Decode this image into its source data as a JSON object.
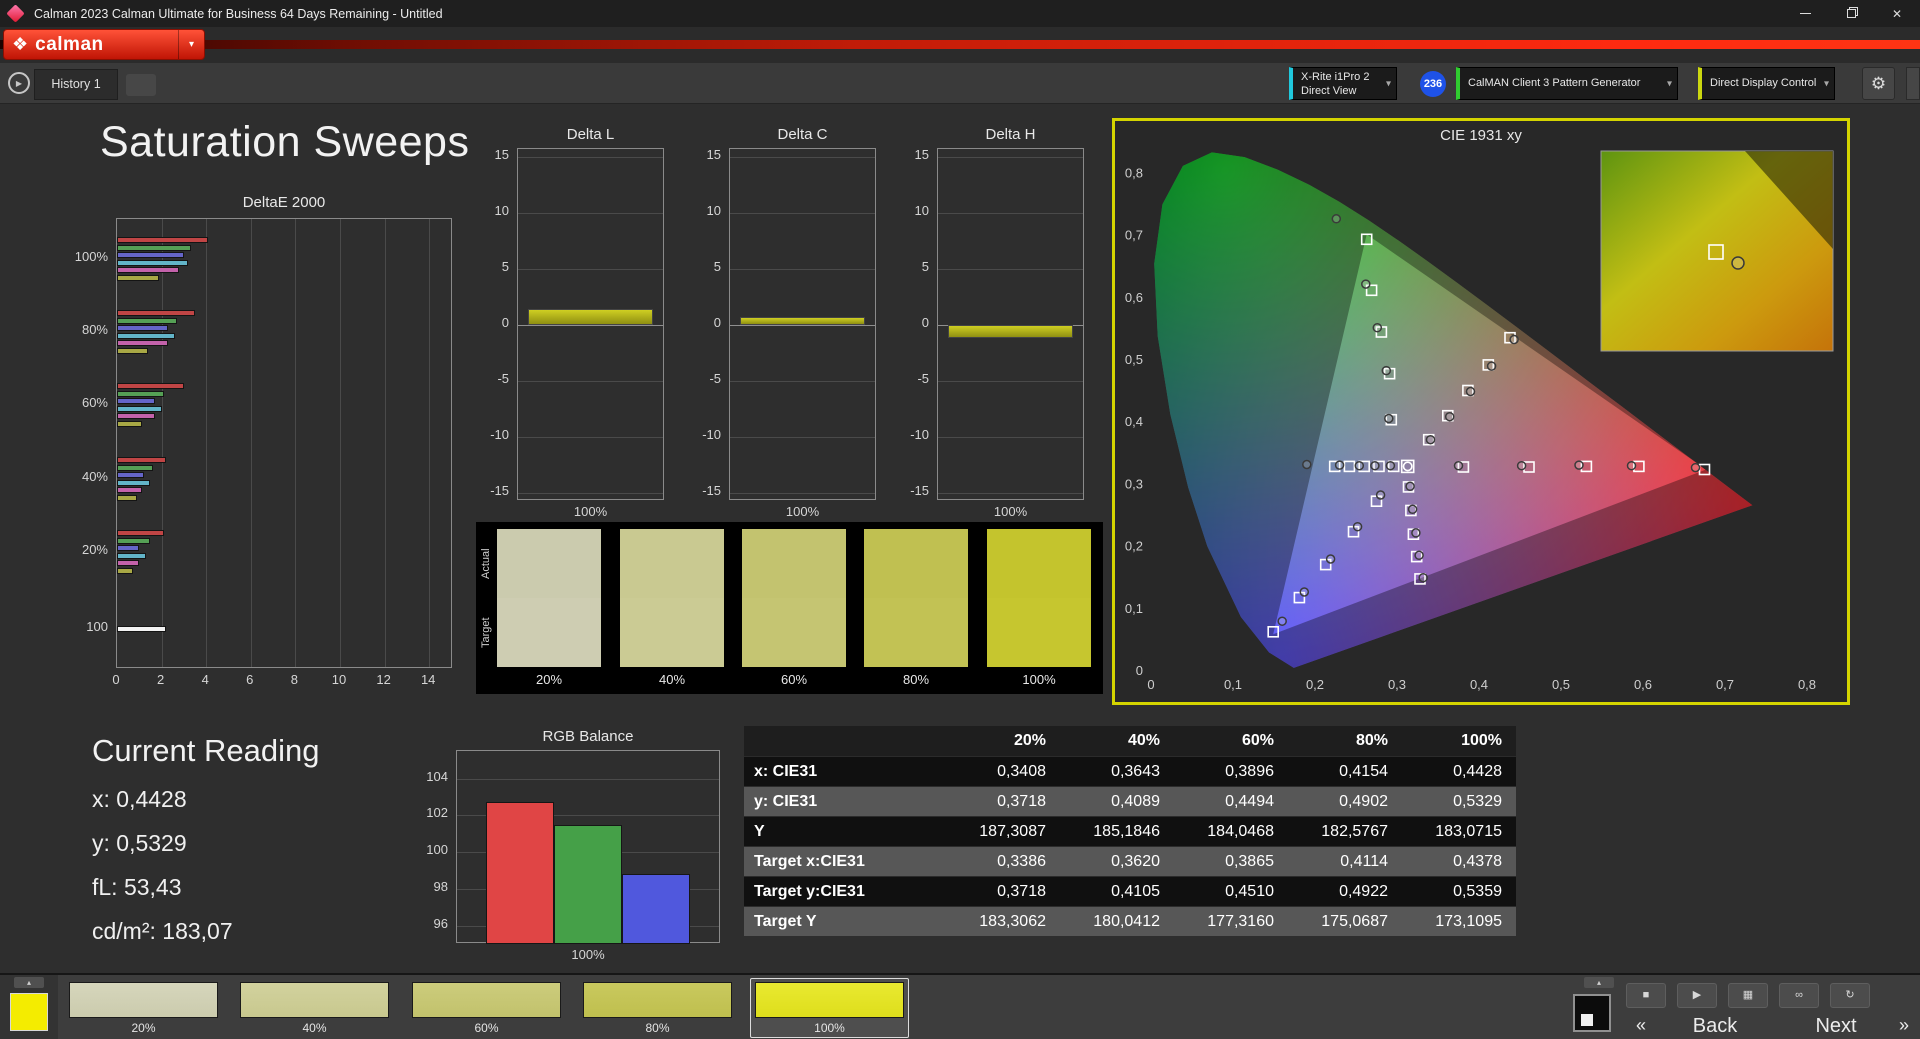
{
  "window": {
    "title": "Calman 2023 Calman Ultimate for Business 64 Days Remaining  - Untitled"
  },
  "brand": {
    "logo_text": "calman"
  },
  "icons": {
    "logo_diamond": "❖",
    "dropdown_caret": "▾",
    "history_arrow": "▶",
    "gear": "⚙",
    "close": "✕",
    "chevron_up": "▴",
    "stop": "■",
    "play": "▶",
    "save": "▦",
    "link": "∞",
    "refresh": "↻",
    "back_arrow": "«",
    "next_arrow": "»"
  },
  "toolbar": {
    "history_tab": "History 1",
    "meter_line1": "X-Rite i1Pro 2",
    "meter_line2": "Direct View",
    "meter_badge": "236",
    "source": "CalMAN Client 3 Pattern Generator",
    "display_control": "Direct Display Control"
  },
  "page_title": "Saturation Sweeps",
  "current_reading": {
    "title": "Current Reading",
    "lines": [
      "x: 0,4428",
      "y: 0,5329",
      "fL: 53,43",
      "cd/m²: 183,07"
    ]
  },
  "bottom_bar": {
    "back_label": "Back",
    "next_label": "Next",
    "pattern_color": "#f4ec00",
    "swatches": [
      {
        "label": "20%",
        "color": "#cbcbad",
        "color_top": "#d6d6bc",
        "selected": false
      },
      {
        "label": "40%",
        "color": "#c8c88e",
        "color_top": "#d2d29e",
        "selected": false
      },
      {
        "label": "60%",
        "color": "#c2c26c",
        "color_top": "#cccc7c",
        "selected": false
      },
      {
        "label": "80%",
        "color": "#bfbf4e",
        "color_top": "#c9c95e",
        "selected": false
      },
      {
        "label": "100%",
        "color": "#dede1c",
        "color_top": "#e9e930",
        "selected": true
      }
    ]
  },
  "chart_data": {
    "deltae": {
      "type": "bar",
      "orientation": "horizontal",
      "title": "DeltaE 2000",
      "xlim": [
        0,
        14
      ],
      "x_ticks": [
        0,
        2,
        4,
        6,
        8,
        10,
        12,
        14
      ],
      "series_colors": {
        "red": "#c04545",
        "green": "#55a055",
        "blue": "#6565c8",
        "cyan": "#62b4c8",
        "magenta": "#c362aa",
        "yellow": "#a8a845",
        "white": "#f2f2f2"
      },
      "groups": [
        {
          "label": "100%",
          "bars": [
            [
              "red",
              4.1
            ],
            [
              "green",
              3.3
            ],
            [
              "blue",
              3.0
            ],
            [
              "cyan",
              3.2
            ],
            [
              "magenta",
              2.8
            ],
            [
              "yellow",
              1.9
            ]
          ]
        },
        {
          "label": "80%",
          "bars": [
            [
              "red",
              3.5
            ],
            [
              "green",
              2.7
            ],
            [
              "blue",
              2.3
            ],
            [
              "cyan",
              2.6
            ],
            [
              "magenta",
              2.3
            ],
            [
              "yellow",
              1.4
            ]
          ]
        },
        {
          "label": "60%",
          "bars": [
            [
              "red",
              3.0
            ],
            [
              "green",
              2.1
            ],
            [
              "blue",
              1.7
            ],
            [
              "cyan",
              2.0
            ],
            [
              "magenta",
              1.7
            ],
            [
              "yellow",
              1.1
            ]
          ]
        },
        {
          "label": "40%",
          "bars": [
            [
              "red",
              2.2
            ],
            [
              "green",
              1.6
            ],
            [
              "blue",
              1.2
            ],
            [
              "cyan",
              1.5
            ],
            [
              "magenta",
              1.1
            ],
            [
              "yellow",
              0.9
            ]
          ]
        },
        {
          "label": "20%",
          "bars": [
            [
              "red",
              2.1
            ],
            [
              "green",
              1.5
            ],
            [
              "blue",
              1.0
            ],
            [
              "cyan",
              1.3
            ],
            [
              "magenta",
              1.0
            ],
            [
              "yellow",
              0.7
            ]
          ]
        },
        {
          "label": "100",
          "bars": [
            [
              "white",
              2.2
            ]
          ]
        }
      ]
    },
    "delta_l": {
      "type": "bar",
      "title": "Delta L",
      "categories": [
        "100%"
      ],
      "values": [
        1.4
      ],
      "ylim": [
        -15,
        15
      ],
      "y_ticks": [
        15,
        10,
        5,
        0,
        -5,
        -10,
        -15
      ],
      "bar_color": "#b5b521"
    },
    "delta_c": {
      "type": "bar",
      "title": "Delta C",
      "categories": [
        "100%"
      ],
      "values": [
        0.7
      ],
      "ylim": [
        -15,
        15
      ],
      "y_ticks": [
        15,
        10,
        5,
        0,
        -5,
        -10,
        -15
      ],
      "bar_color": "#b5b521"
    },
    "delta_h": {
      "type": "bar",
      "title": "Delta H",
      "categories": [
        "100%"
      ],
      "values": [
        -1.2
      ],
      "ylim": [
        -15,
        15
      ],
      "y_ticks": [
        15,
        10,
        5,
        0,
        -5,
        -10,
        -15
      ],
      "bar_color": "#b5b521"
    },
    "cie": {
      "type": "scatter",
      "title": "CIE 1931 xy",
      "xlim": [
        0,
        0.8
      ],
      "ylim": [
        0,
        0.8
      ],
      "x_ticks": [
        "0",
        "0,1",
        "0,2",
        "0,3",
        "0,4",
        "0,5",
        "0,6",
        "0,7",
        "0,8"
      ],
      "y_ticks": [
        "0",
        "0,1",
        "0,2",
        "0,3",
        "0,4",
        "0,5",
        "0,6",
        "0,7",
        "0,8"
      ],
      "white_point": [
        0.313,
        0.329
      ],
      "gamut_triangle": [
        [
          0.677,
          0.324
        ],
        [
          0.263,
          0.702
        ],
        [
          0.149,
          0.059
        ]
      ],
      "sweeps": [
        {
          "name": "red",
          "targets": [
            [
              0.381,
              0.328
            ],
            [
              0.461,
              0.328
            ],
            [
              0.531,
              0.329
            ],
            [
              0.595,
              0.329
            ],
            [
              0.675,
              0.324
            ]
          ],
          "measured": [
            [
              0.375,
              0.33
            ],
            [
              0.452,
              0.33
            ],
            [
              0.522,
              0.331
            ],
            [
              0.586,
              0.33
            ],
            [
              0.664,
              0.327
            ]
          ]
        },
        {
          "name": "green",
          "targets": [
            [
              0.293,
              0.404
            ],
            [
              0.291,
              0.478
            ],
            [
              0.281,
              0.545
            ],
            [
              0.269,
              0.612
            ],
            [
              0.263,
              0.694
            ]
          ],
          "measured": [
            [
              0.29,
              0.406
            ],
            [
              0.287,
              0.483
            ],
            [
              0.276,
              0.552
            ],
            [
              0.262,
              0.622
            ],
            [
              0.226,
              0.727
            ]
          ]
        },
        {
          "name": "blue",
          "targets": [
            [
              0.275,
              0.273
            ],
            [
              0.247,
              0.224
            ],
            [
              0.213,
              0.171
            ],
            [
              0.181,
              0.118
            ],
            [
              0.149,
              0.063
            ]
          ],
          "measured": [
            [
              0.28,
              0.283
            ],
            [
              0.252,
              0.232
            ],
            [
              0.219,
              0.18
            ],
            [
              0.187,
              0.127
            ],
            [
              0.16,
              0.08
            ]
          ]
        },
        {
          "name": "cyan",
          "targets": [
            [
              0.296,
              0.329
            ],
            [
              0.278,
              0.329
            ],
            [
              0.26,
              0.329
            ],
            [
              0.242,
              0.329
            ],
            [
              0.224,
              0.329
            ]
          ],
          "measured": [
            [
              0.292,
              0.33
            ],
            [
              0.273,
              0.33
            ],
            [
              0.254,
              0.33
            ],
            [
              0.23,
              0.331
            ],
            [
              0.19,
              0.332
            ]
          ]
        },
        {
          "name": "magenta",
          "targets": [
            [
              0.314,
              0.296
            ],
            [
              0.317,
              0.258
            ],
            [
              0.32,
              0.22
            ],
            [
              0.324,
              0.184
            ],
            [
              0.328,
              0.148
            ]
          ],
          "measured": [
            [
              0.316,
              0.297
            ],
            [
              0.319,
              0.26
            ],
            [
              0.323,
              0.222
            ],
            [
              0.327,
              0.186
            ],
            [
              0.332,
              0.15
            ]
          ]
        },
        {
          "name": "yellow",
          "targets": [
            [
              0.3386,
              0.3718
            ],
            [
              0.362,
              0.4105
            ],
            [
              0.3865,
              0.451
            ],
            [
              0.4114,
              0.4922
            ],
            [
              0.4378,
              0.5359
            ]
          ],
          "measured": [
            [
              0.3408,
              0.3718
            ],
            [
              0.3643,
              0.4089
            ],
            [
              0.3896,
              0.4494
            ],
            [
              0.4154,
              0.4902
            ],
            [
              0.4428,
              0.5329
            ]
          ]
        }
      ]
    },
    "saturation_swatches": {
      "type": "swatches",
      "row_labels": [
        "Actual",
        "Target"
      ],
      "columns": [
        "20%",
        "40%",
        "60%",
        "80%",
        "100%"
      ],
      "actual_colors": [
        "#cbcbae",
        "#c9c991",
        "#c3c36f",
        "#c0c051",
        "#c4c42d"
      ],
      "target_colors": [
        "#cecdb2",
        "#cbcb94",
        "#c5c572",
        "#c2c254",
        "#c6c62f"
      ]
    },
    "rgb_balance": {
      "type": "bar",
      "title": "RGB Balance",
      "categories": [
        "Red",
        "Green",
        "Blue"
      ],
      "values": [
        102.7,
        101.5,
        98.8
      ],
      "colors": [
        "#e04545",
        "#45a048",
        "#5058dd"
      ],
      "ylim": [
        95,
        105.5
      ],
      "y_ticks": [
        104,
        102,
        100,
        98,
        96
      ],
      "xlabel": "100%"
    },
    "measurement_table": {
      "type": "table",
      "columns": [
        "",
        "20%",
        "40%",
        "60%",
        "80%",
        "100%"
      ],
      "rows": [
        {
          "label": "x: CIE31",
          "values": [
            "0,3408",
            "0,3643",
            "0,3896",
            "0,4154",
            "0,4428"
          ]
        },
        {
          "label": "y: CIE31",
          "values": [
            "0,3718",
            "0,4089",
            "0,4494",
            "0,4902",
            "0,5329"
          ]
        },
        {
          "label": "Y",
          "values": [
            "187,3087",
            "185,1846",
            "184,0468",
            "182,5767",
            "183,0715"
          ]
        },
        {
          "label": "Target x:CIE31",
          "values": [
            "0,3386",
            "0,3620",
            "0,3865",
            "0,4114",
            "0,4378"
          ]
        },
        {
          "label": "Target y:CIE31",
          "values": [
            "0,3718",
            "0,4105",
            "0,4510",
            "0,4922",
            "0,5359"
          ]
        },
        {
          "label": "Target Y",
          "values": [
            "183,3062",
            "180,0412",
            "177,3160",
            "175,0687",
            "173,1095"
          ]
        }
      ]
    }
  }
}
